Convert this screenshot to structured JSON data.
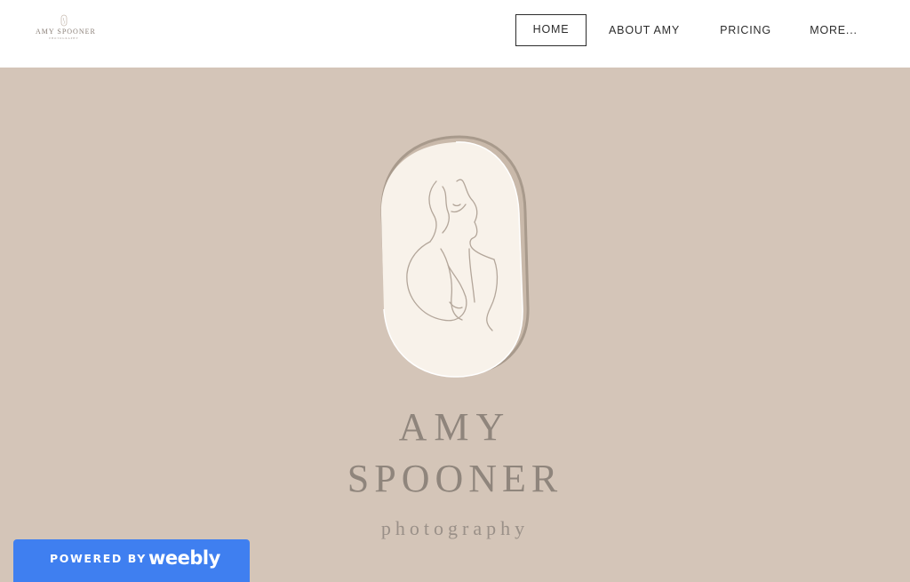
{
  "header": {
    "logo": {
      "name": "AMY SPOONER",
      "subtitle": "PHOTOGRAPHY"
    },
    "nav": [
      {
        "label": "HOME",
        "active": true
      },
      {
        "label": "ABOUT AMY",
        "active": false
      },
      {
        "label": "PRICING",
        "active": false
      },
      {
        "label": "MORE...",
        "active": false
      }
    ]
  },
  "hero": {
    "emblem_icon": "woman-line-drawing-icon",
    "brand_line1": "AMY",
    "brand_line2": "SPOONER",
    "brand_line3": "photography"
  },
  "footer_badge": {
    "powered_by": "POWERED BY",
    "brand": "weebly"
  },
  "colors": {
    "header_background": "#ffffff",
    "hero_background": "#d4c5b8",
    "emblem_fill": "#f8f2ea",
    "emblem_outline": "#a89a8c",
    "brand_text": "#8f857c",
    "badge_background": "#3f7ff0"
  }
}
